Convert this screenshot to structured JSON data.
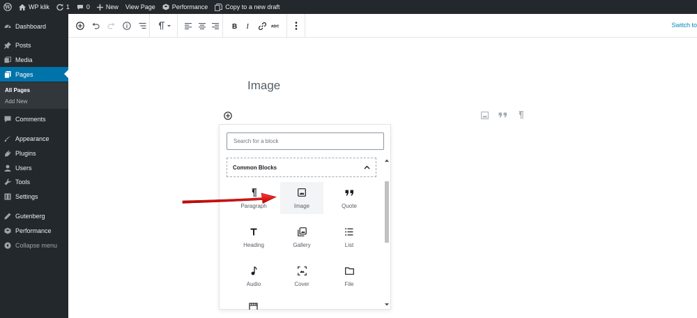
{
  "admin_bar": {
    "site_name": "WP klik",
    "updates_count": "1",
    "comments_count": "0",
    "new_label": "New",
    "view_page_label": "View Page",
    "performance_label": "Performance",
    "copy_draft_label": "Copy to a new draft"
  },
  "sidebar": {
    "items": [
      {
        "label": "Dashboard",
        "icon": "dashboard-icon"
      },
      {
        "label": "Posts",
        "icon": "pin-icon"
      },
      {
        "label": "Media",
        "icon": "media-icon"
      },
      {
        "label": "Pages",
        "icon": "pages-icon"
      },
      {
        "label": "Comments",
        "icon": "comment-icon"
      },
      {
        "label": "Appearance",
        "icon": "brush-icon"
      },
      {
        "label": "Plugins",
        "icon": "plug-icon"
      },
      {
        "label": "Users",
        "icon": "user-icon"
      },
      {
        "label": "Tools",
        "icon": "wrench-icon"
      },
      {
        "label": "Settings",
        "icon": "settings-icon"
      },
      {
        "label": "Gutenberg",
        "icon": "pencil-icon"
      },
      {
        "label": "Performance",
        "icon": "performance-icon"
      }
    ],
    "submenu": [
      "All Pages",
      "Add New"
    ],
    "collapse_label": "Collapse menu",
    "active_color": "#0073aa"
  },
  "toolbar": {
    "switch_to_label": "Switch to"
  },
  "editor": {
    "title": "Image"
  },
  "inserter": {
    "search_placeholder": "Search for a block",
    "section_label": "Common Blocks",
    "blocks": [
      {
        "label": "Paragraph",
        "icon": "paragraph-icon"
      },
      {
        "label": "Image",
        "icon": "image-icon"
      },
      {
        "label": "Quote",
        "icon": "quote-icon"
      },
      {
        "label": "Heading",
        "icon": "heading-icon"
      },
      {
        "label": "Gallery",
        "icon": "gallery-icon"
      },
      {
        "label": "List",
        "icon": "list-icon"
      },
      {
        "label": "Audio",
        "icon": "audio-icon"
      },
      {
        "label": "Cover",
        "icon": "cover-icon"
      },
      {
        "label": "File",
        "icon": "file-icon"
      }
    ]
  },
  "annotation": {
    "arrow_color": "#e02020"
  }
}
